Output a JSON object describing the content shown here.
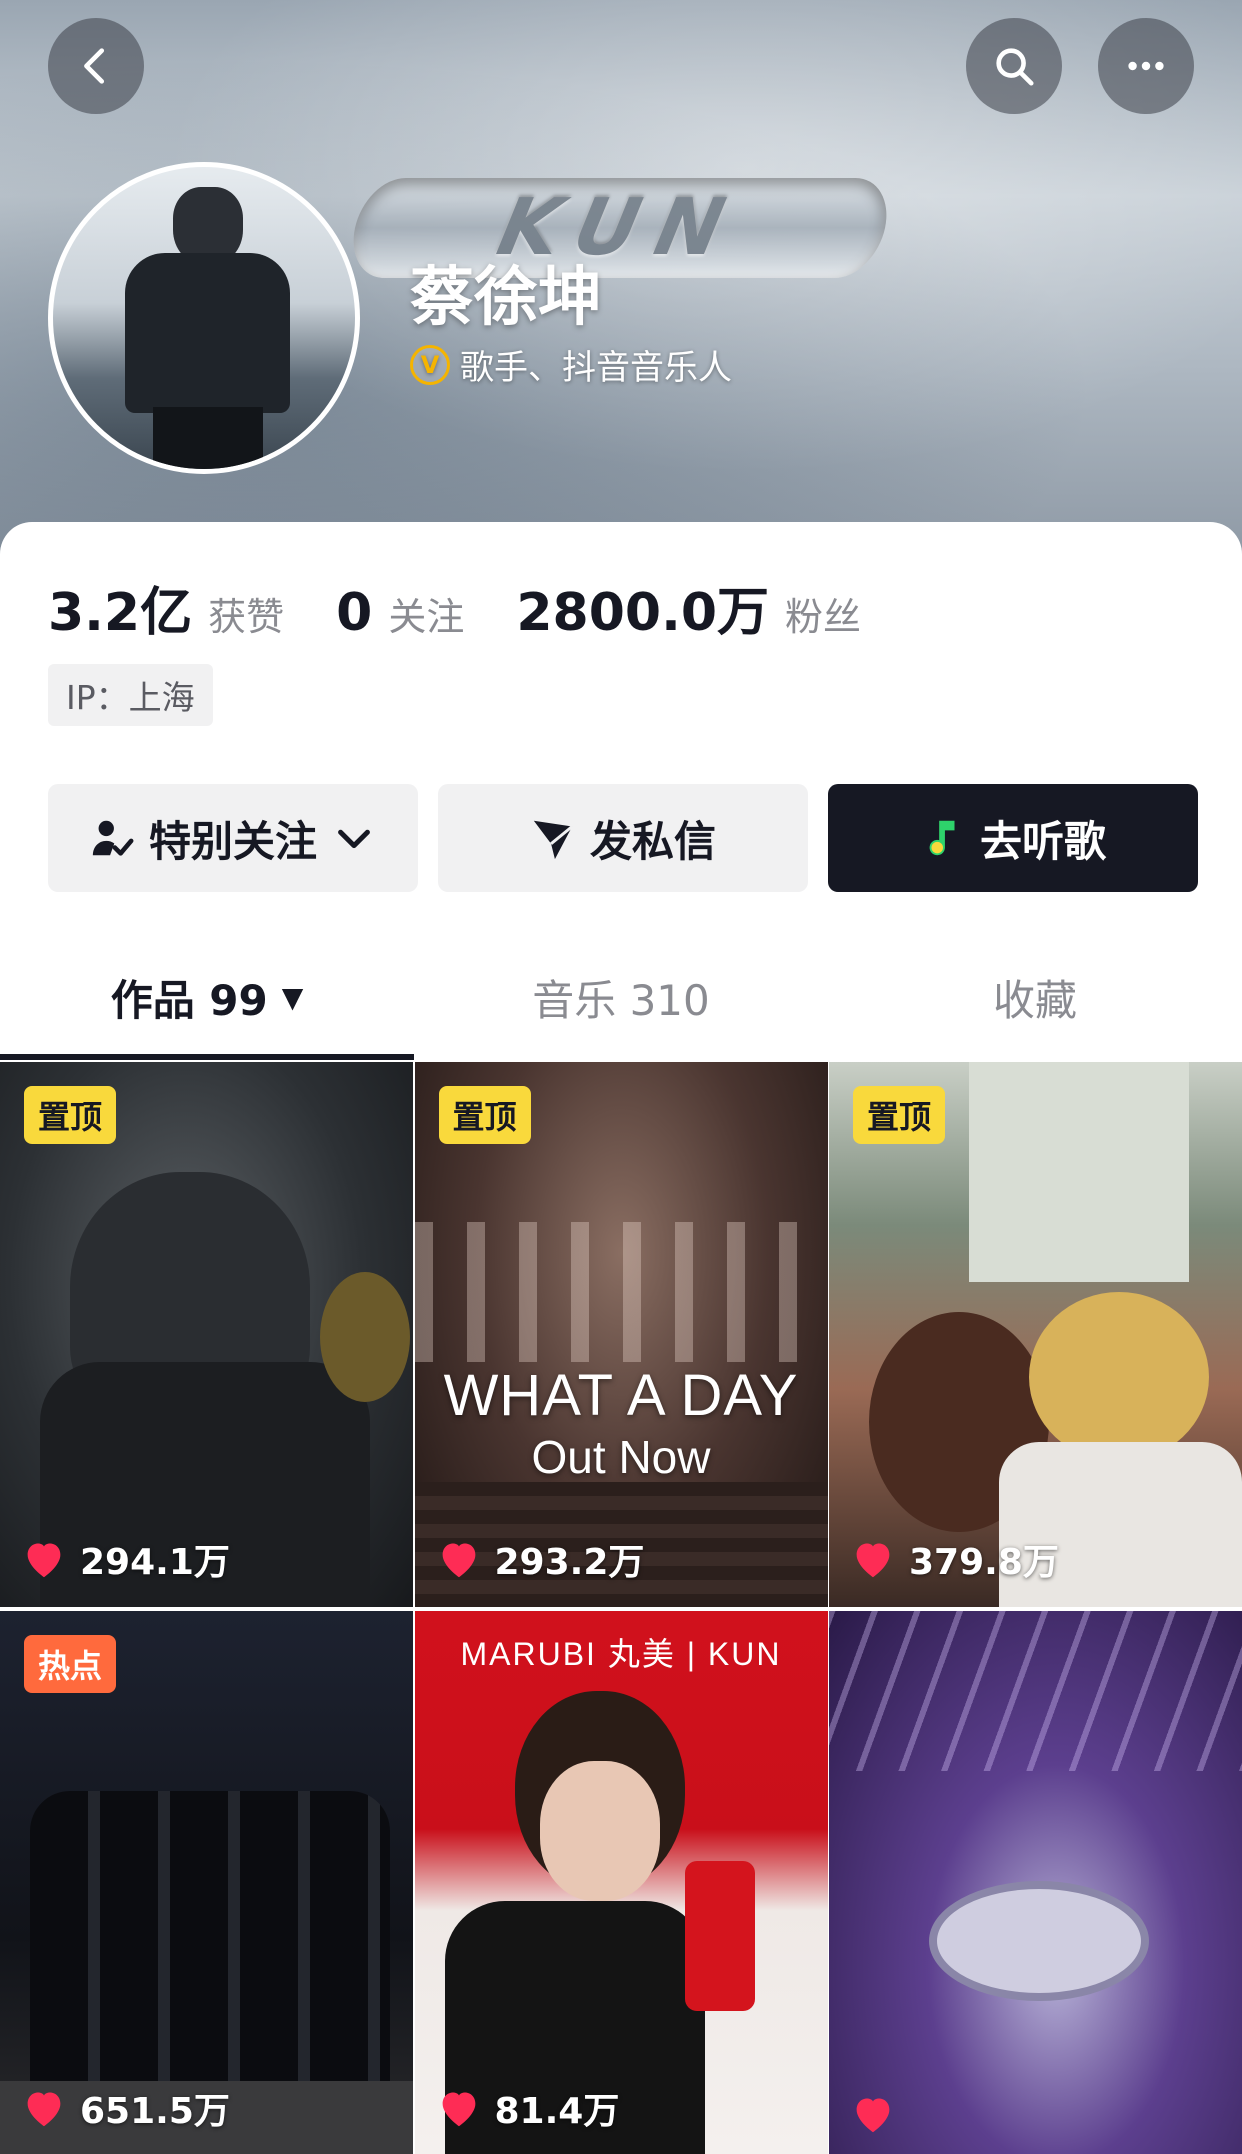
{
  "header": {
    "banner_logo_text": "KUN",
    "name": "蔡徐坤",
    "verified_badge": "V",
    "verified_text": "歌手、抖音音乐人"
  },
  "stats": [
    {
      "value": "3.2亿",
      "label": "获赞"
    },
    {
      "value": "0",
      "label": "关注"
    },
    {
      "value": "2800.0万",
      "label": "粉丝"
    }
  ],
  "ip": "IP：上海",
  "actions": {
    "follow": "特别关注",
    "message": "发私信",
    "listen": "去听歌"
  },
  "tabs": [
    {
      "label": "作品 99",
      "caret": "▼"
    },
    {
      "label": "音乐 310"
    },
    {
      "label": "收藏"
    }
  ],
  "videos": [
    {
      "badge": "置顶",
      "likes": "294.1万"
    },
    {
      "badge": "置顶",
      "likes": "293.2万",
      "title": "WHAT A DAY",
      "subtitle": "Out Now"
    },
    {
      "badge": "置顶",
      "likes": "379.8万"
    },
    {
      "badge": "热点",
      "likes": "651.5万"
    },
    {
      "likes": "81.4万",
      "brand": "MARUBI 丸美 | KUN"
    },
    {
      "likes": ""
    }
  ],
  "colors": {
    "pinned_badge": "#f9d93c",
    "hot_badge": "#ff6a3d",
    "primary_button": "#161823",
    "verified": "#f5b400",
    "like_heart": "#fe2c55"
  }
}
